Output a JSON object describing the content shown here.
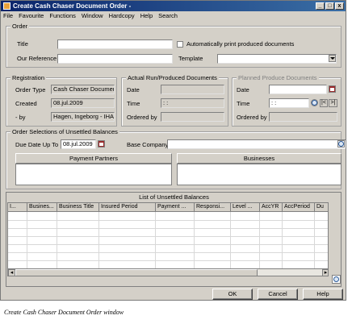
{
  "window": {
    "title": "Create Cash Chaser Document  Order -",
    "controls": [
      "_",
      "□",
      "x"
    ]
  },
  "menu": [
    "File",
    "Favourite",
    "Functions",
    "Window",
    "Hardcopy",
    "Help",
    "Search"
  ],
  "order": {
    "group_title": "Order",
    "title_label": "Title",
    "title_value": "",
    "auto_print_label": "Automatically print produced documents",
    "our_reference_label": "Our Reference",
    "our_reference_value": "",
    "template_label": "Template",
    "template_value": ""
  },
  "registration": {
    "group_title": "Registration",
    "order_type_label": "Order Type",
    "order_type_value": "Cash Chaser Document",
    "created_label": "Created",
    "created_value": "08.jul.2009",
    "by_label": "- by",
    "by_value": "Hagen, Ingeborg - IHA("
  },
  "actual_run": {
    "group_title": "Actual Run/Produced Documents",
    "date_label": "Date",
    "date_value": "",
    "time_label": "Time",
    "time_value": ": :",
    "ordered_by_label": "Ordered by",
    "ordered_by_value": ""
  },
  "planned": {
    "group_title": "Planned Produce Documents",
    "date_label": "Date",
    "date_value": "",
    "time_label": "Time",
    "time_value": ": :",
    "ordered_by_label": "Ordered by",
    "ordered_by_value": "",
    "nav_prev": "|<",
    "nav_next": ">|"
  },
  "selections": {
    "group_title": "Order Selections of Unsettled Balances",
    "due_date_label": "Due Date Up To",
    "due_date_value": "08.jul.2009",
    "base_company_label": "Base Company",
    "base_company_value": "",
    "payment_partners_header": "Payment Partners",
    "businesses_header": "Businesses"
  },
  "list": {
    "title": "List of Unsettled Balances",
    "columns": [
      "I...",
      "Busines...",
      "Business Title",
      "Insured Period",
      "Payment ...",
      "Responsi...",
      "Level ...",
      "AccYR",
      "AccPeriod",
      "Du"
    ]
  },
  "buttons": {
    "ok": "OK",
    "cancel": "Cancel",
    "help": "Help"
  },
  "caption": "Create Cash Chaser Document Order window",
  "colors": {
    "title_bar_start": "#0a246a",
    "title_bar_end": "#3a6ea5",
    "face": "#d4d0c8"
  }
}
